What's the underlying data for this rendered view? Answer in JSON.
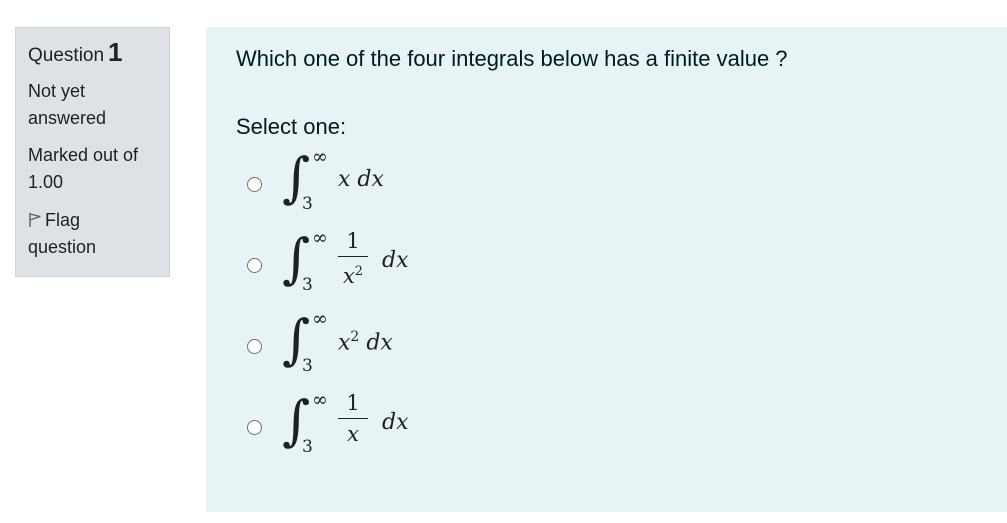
{
  "info": {
    "question_label": "Question",
    "question_number": "1",
    "state": "Not yet answered",
    "grade": "Marked out of 1.00",
    "flag_label": "Flag question"
  },
  "question": {
    "text": "Which one of the four integrals below has a finite value ?",
    "prompt": "Select one:"
  },
  "options": [
    {
      "lower": "3",
      "upper": "∞",
      "integrand": "x",
      "differential": "dx"
    },
    {
      "lower": "3",
      "upper": "∞",
      "numerator": "1",
      "denominator": "x",
      "denominator_power": "2",
      "differential": "dx"
    },
    {
      "lower": "3",
      "upper": "∞",
      "integrand": "x",
      "integrand_power": "2",
      "differential": "dx"
    },
    {
      "lower": "3",
      "upper": "∞",
      "numerator": "1",
      "denominator": "x",
      "differential": "dx"
    }
  ],
  "integral_symbol": "∫"
}
